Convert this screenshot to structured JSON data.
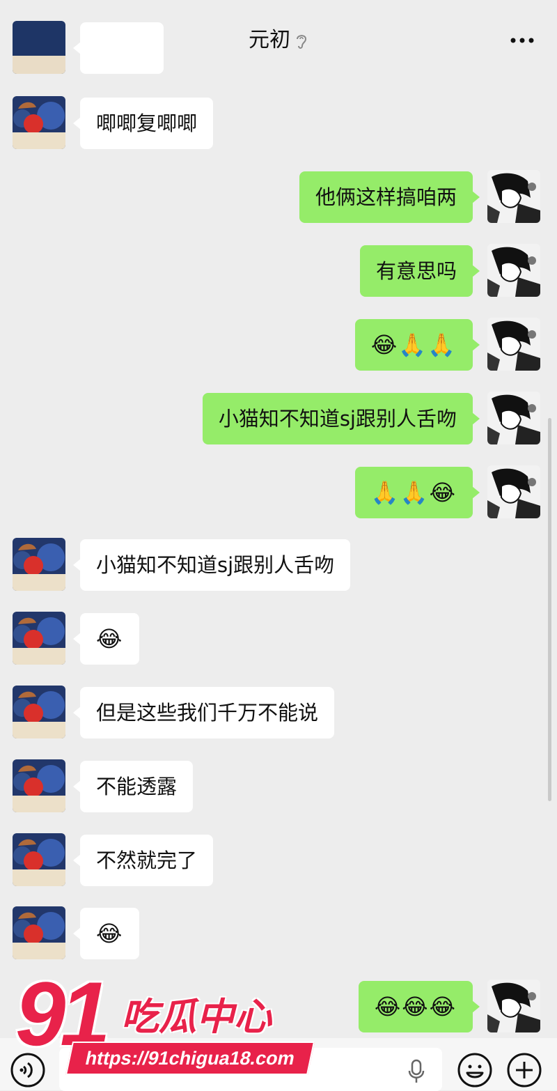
{
  "header": {
    "title": "元初",
    "back_icon": "chevron-left-icon",
    "ear_icon": "ear-icon",
    "more_icon": "more-dots-icon"
  },
  "messages": [
    {
      "side": "left",
      "text": "",
      "partial": true
    },
    {
      "side": "left",
      "text": "唧唧复唧唧"
    },
    {
      "side": "right",
      "text": "他俩这样搞咱两"
    },
    {
      "side": "right",
      "text": "有意思吗"
    },
    {
      "side": "right",
      "text": "😂🙏🙏"
    },
    {
      "side": "right",
      "text": "小猫知不知道sj跟别人舌吻"
    },
    {
      "side": "right",
      "text": "🙏🙏😂"
    },
    {
      "side": "left",
      "text": "小猫知不知道sj跟别人舌吻"
    },
    {
      "side": "left",
      "text": "😂"
    },
    {
      "side": "left",
      "text": "但是这些我们千万不能说"
    },
    {
      "side": "left",
      "text": "不能透露"
    },
    {
      "side": "left",
      "text": "不然就完了"
    },
    {
      "side": "left",
      "text": "😂"
    },
    {
      "side": "right",
      "text": "😂😂😂"
    }
  ],
  "input_bar": {
    "voice_icon": "voice-icon",
    "mic_icon": "microphone-icon",
    "emoji_icon": "smiley-icon",
    "plus_icon": "plus-circle-icon",
    "placeholder": ""
  },
  "watermark": {
    "number": "91",
    "text": "吃瓜中心",
    "url": "https://91chigua18.com"
  },
  "colors": {
    "background": "#ededed",
    "sent_bubble": "#95ec69",
    "received_bubble": "#ffffff",
    "watermark_red": "#e8224a"
  }
}
